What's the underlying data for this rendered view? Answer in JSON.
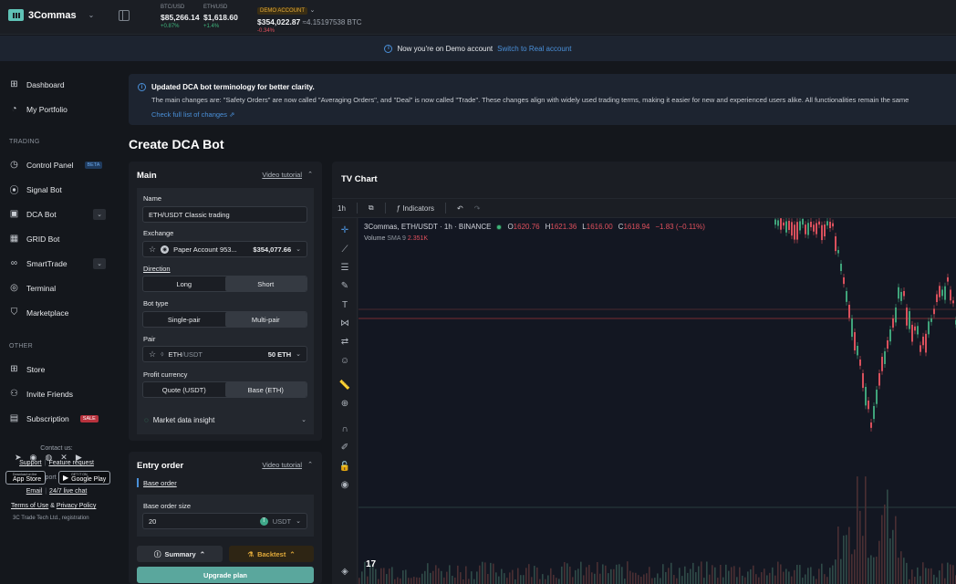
{
  "topbar": {
    "brand": "3Commas",
    "tickers": [
      {
        "label": "BTC/USD",
        "price": "$85,266.14",
        "change": "+0.87%"
      },
      {
        "label": "ETH/USD",
        "price": "$1,618.60",
        "change": "+1.4%"
      }
    ],
    "account": {
      "badge": "DEMO ACCOUNT",
      "balance": "$354,022.87",
      "btc": "≈4.15197538 BTC",
      "change": "-0.34%"
    }
  },
  "notice": {
    "text": "Now you're on Demo account",
    "link": "Switch to Real account"
  },
  "sidebar": {
    "items_top": [
      {
        "label": "Dashboard",
        "icon": "grid-icon"
      },
      {
        "label": "My Portfolio",
        "icon": "pie-icon"
      }
    ],
    "section_trading": "TRADING",
    "trading_items": [
      {
        "label": "Control Panel",
        "badge": "BETA"
      },
      {
        "label": "Signal Bot"
      },
      {
        "label": "DCA Bot"
      },
      {
        "label": "GRID Bot"
      },
      {
        "label": "SmartTrade"
      },
      {
        "label": "Terminal"
      },
      {
        "label": "Marketplace"
      }
    ],
    "section_other": "OTHER",
    "other_items": [
      {
        "label": "Store"
      },
      {
        "label": "Invite Friends"
      },
      {
        "label": "Subscription",
        "badge": "SALE"
      }
    ],
    "contact": {
      "title": "Contact us:",
      "support": "Support",
      "feature": "Feature request",
      "service": "Support Service",
      "email": "Email",
      "live": "24/7 live chat"
    },
    "stores": {
      "apple_small": "Download on the",
      "apple": "App Store",
      "google_small": "GET IT ON",
      "google": "Google Play"
    },
    "footer": {
      "terms": "Terms of Use",
      "amp": "&",
      "privacy": "Privacy Policy",
      "copy": "3C Trade Tech Ltd., registration"
    }
  },
  "banner": {
    "title": "Updated DCA bot terminology for better clarity.",
    "body": "The main changes are: \"Safety Orders\" are now called \"Averaging Orders\", and \"Deal\" is now called \"Trade\". These changes align with widely used trading terms, making it easier for new and experienced users alike. All functionalities remain the same",
    "link": "Check full list of changes"
  },
  "page_title": "Create DCA Bot",
  "main_card": {
    "title": "Main",
    "video": "Video tutorial",
    "name_label": "Name",
    "name_value": "ETH/USDT Classic trading",
    "exchange_label": "Exchange",
    "exchange_name": "Paper Account 953...",
    "exchange_balance": "$354,077.66",
    "direction_label": "Direction",
    "direction_options": [
      "Long",
      "Short"
    ],
    "bottype_label": "Bot type",
    "bottype_options": [
      "Single-pair",
      "Multi-pair"
    ],
    "pair_label": "Pair",
    "pair_base": "ETH",
    "pair_quote": "/USDT",
    "pair_amount": "50 ETH",
    "profit_label": "Profit currency",
    "profit_options": [
      "Quote (USDT)",
      "Base (ETH)"
    ],
    "insight": "Market data insight"
  },
  "entry_card": {
    "title": "Entry order",
    "video": "Video tutorial",
    "base_order": "Base order",
    "size_label": "Base order size",
    "size_value": "20",
    "size_currency": "USDT"
  },
  "actions": {
    "summary": "Summary",
    "backtest": "Backtest",
    "upgrade": "Upgrade plan"
  },
  "chart": {
    "panel_title": "TV Chart",
    "interval": "1h",
    "indicators": "Indicators",
    "symbol": "3Commas, ETH/USDT · 1h · BINANCE",
    "o": "1620.76",
    "h": "1621.36",
    "l": "1616.00",
    "c": "1618.94",
    "change": "−1.83 (−0.11%)",
    "volume_label": "Volume",
    "volume_sma": "SMA 9",
    "volume_value": "2.351K",
    "logo": "17"
  }
}
